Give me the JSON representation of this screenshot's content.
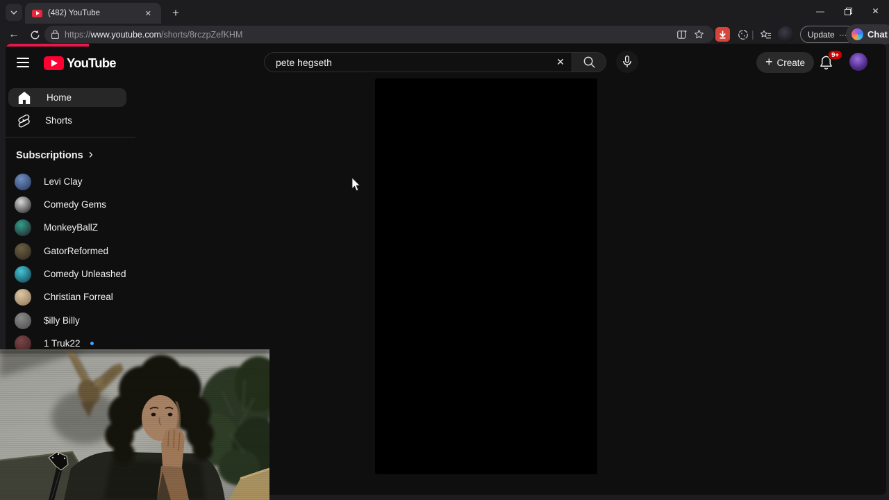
{
  "browser": {
    "tab_title": "(482) YouTube",
    "url_scheme": "https://",
    "url_host": "www.youtube.com",
    "url_path": "/shorts/8rczpZefKHM",
    "update_label": "Update",
    "chat_label": "Chat"
  },
  "icons": {
    "tab_close": "✕",
    "new_tab": "+",
    "minimize": "—",
    "window_close": "✕",
    "back": "←",
    "divider": "|",
    "update_more": "···",
    "clear_search": "✕",
    "create_plus": "+",
    "subs_chevron": "›"
  },
  "masthead": {
    "wordmark": "YouTube",
    "search_value": "pete hegseth",
    "create_label": "Create",
    "notification_count": "9+"
  },
  "sidebar": {
    "home_label": "Home",
    "shorts_label": "Shorts",
    "subscriptions_header": "Subscriptions",
    "subscriptions": [
      {
        "name": "Levi Clay",
        "c1": "#23355c",
        "c2": "#6f8fc0",
        "new": false
      },
      {
        "name": "Comedy Gems",
        "c1": "#1a1a1a",
        "c2": "#d8d8d8",
        "new": false
      },
      {
        "name": "MonkeyBallZ",
        "c1": "#27161f",
        "c2": "#2fa08c",
        "new": false
      },
      {
        "name": "GatorReformed",
        "c1": "#2e281c",
        "c2": "#6b5f43",
        "new": false
      },
      {
        "name": "Comedy Unleashed",
        "c1": "#0f3b46",
        "c2": "#46c4d8",
        "new": false
      },
      {
        "name": "Christian Forreal",
        "c1": "#8a7354",
        "c2": "#ddc7a4",
        "new": false
      },
      {
        "name": "$illy Billy",
        "c1": "#4a4a4a",
        "c2": "#8a8a8a",
        "new": false
      },
      {
        "name": "1 Truk22",
        "c1": "#3c1f22",
        "c2": "#7a4648",
        "new": true
      }
    ]
  },
  "colors": {
    "youtube_red": "#ff0033",
    "loading_bar": "#e9184c",
    "badge_red": "#cc0000",
    "new_content_blue": "#3ea6ff",
    "page_bg": "#0f0f0f",
    "chrome_bg": "#1d1d20"
  }
}
